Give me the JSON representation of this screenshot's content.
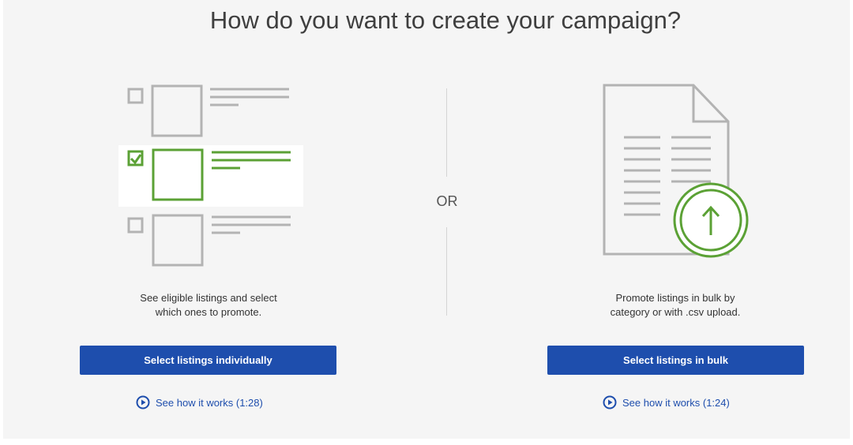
{
  "page": {
    "title": "How do you want to create your campaign?",
    "separator_label": "OR"
  },
  "individual": {
    "description_line1": "See eligible listings and select",
    "description_line2": "which ones to promote.",
    "button_label": "Select listings individually",
    "video_link_label": "See how it works (1:28)",
    "icon": "listings-checklist-illustration"
  },
  "bulk": {
    "description_line1": "Promote listings in bulk by",
    "description_line2": "category or with .csv upload.",
    "button_label": "Select listings in bulk",
    "video_link_label": "See how it works (1:24)",
    "icon": "document-upload-illustration"
  },
  "colors": {
    "primary_button": "#1e4ead",
    "accent_green": "#5ba135",
    "illustration_gray": "#b3b3b3",
    "background": "#f5f5f5"
  }
}
